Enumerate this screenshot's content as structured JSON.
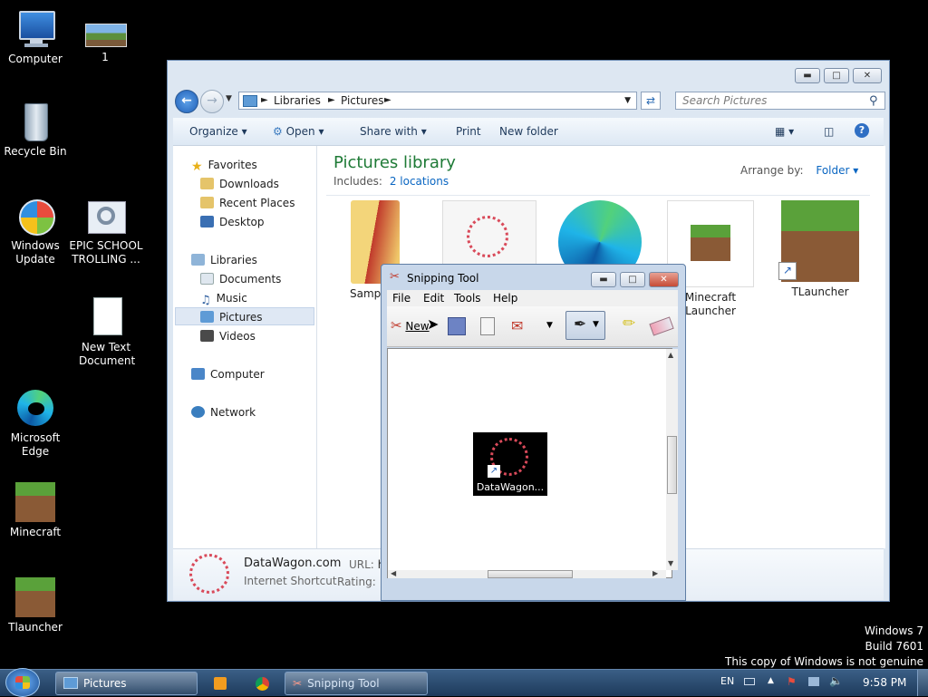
{
  "desktop": {
    "icons": [
      {
        "label": "Computer"
      },
      {
        "label": "1"
      },
      {
        "label": "Recycle Bin"
      },
      {
        "label": "Windows Update"
      },
      {
        "label": "EPIC SCHOOL TROLLING ..."
      },
      {
        "label": "New Text Document"
      },
      {
        "label": "Microsoft Edge"
      },
      {
        "label": "Minecraft"
      },
      {
        "label": "Tlauncher"
      }
    ],
    "watermark": {
      "line1": "Windows 7",
      "line2": "Build 7601",
      "line3": "This copy of Windows is not genuine"
    }
  },
  "explorer": {
    "breadcrumb": [
      "Libraries",
      "Pictures"
    ],
    "search_placeholder": "Search Pictures",
    "toolbar": {
      "organize": "Organize",
      "open": "Open",
      "share_with": "Share with",
      "print": "Print",
      "new_folder": "New folder"
    },
    "nav": {
      "favorites": "Favorites",
      "downloads": "Downloads",
      "recent_places": "Recent Places",
      "desktop": "Desktop",
      "libraries": "Libraries",
      "documents": "Documents",
      "music": "Music",
      "pictures": "Pictures",
      "videos": "Videos",
      "computer": "Computer",
      "network": "Network"
    },
    "library": {
      "title": "Pictures library",
      "includes_label": "Includes:",
      "includes_link": "2 locations",
      "arrange_label": "Arrange by:",
      "arrange_value": "Folder"
    },
    "thumbnails": [
      {
        "label": "Sample P"
      },
      {
        "label": ""
      },
      {
        "label": ""
      },
      {
        "label": "Minecraft Launcher"
      },
      {
        "label": "TLauncher"
      }
    ],
    "details": {
      "name": "DataWagon.com",
      "type": "Internet Shortcut",
      "url_label": "URL:",
      "url_value": "h",
      "rating_label": "Rating:"
    }
  },
  "snipping_tool": {
    "title": "Snipping Tool",
    "menu": {
      "file": "File",
      "edit": "Edit",
      "tools": "Tools",
      "help": "Help"
    },
    "new_label": "New",
    "captured_item": "DataWagon..."
  },
  "taskbar": {
    "pictures": "Pictures",
    "snipping_tool": "Snipping Tool",
    "language": "EN",
    "time": "9:58 PM"
  }
}
